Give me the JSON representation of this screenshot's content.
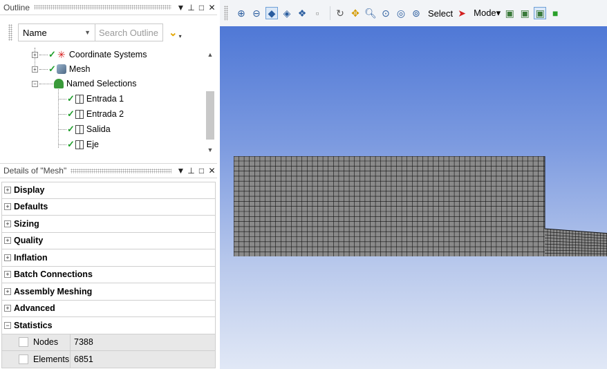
{
  "outline": {
    "title": "Outline",
    "pin": "⊥",
    "restore": "□",
    "close": "✕",
    "dropdown": "▼",
    "filter_select": "Name",
    "search_placeholder": "Search Outline",
    "tree": [
      {
        "label": "Coordinate Systems",
        "icon": "coordinate-systems-icon",
        "expander": "+"
      },
      {
        "label": "Mesh",
        "icon": "mesh-icon",
        "expander": "+"
      },
      {
        "label": "Named Selections",
        "icon": "named-selections-icon",
        "expander": "−"
      },
      {
        "label": "Entrada 1",
        "icon": "face-selection-icon"
      },
      {
        "label": "Entrada 2",
        "icon": "face-selection-icon"
      },
      {
        "label": "Salida",
        "icon": "face-selection-icon"
      },
      {
        "label": "Eje",
        "icon": "face-selection-icon"
      }
    ]
  },
  "details": {
    "title": "Details of \"Mesh\"",
    "sections": [
      {
        "label": "Display",
        "state": "+"
      },
      {
        "label": "Defaults",
        "state": "+"
      },
      {
        "label": "Sizing",
        "state": "+"
      },
      {
        "label": "Quality",
        "state": "+"
      },
      {
        "label": "Inflation",
        "state": "+"
      },
      {
        "label": "Batch Connections",
        "state": "+"
      },
      {
        "label": "Assembly Meshing",
        "state": "+"
      },
      {
        "label": "Advanced",
        "state": "+"
      },
      {
        "label": "Statistics",
        "state": "−"
      }
    ],
    "statistics": [
      {
        "label": "Nodes",
        "value": "7388"
      },
      {
        "label": "Elements",
        "value": "6851"
      }
    ]
  },
  "toolbar": {
    "select_label": "Select",
    "mode_label": "Mode▾"
  },
  "colors": {
    "viewport_top": "#4f78d6",
    "viewport_bottom": "#e1e8f6",
    "mesh_fill": "#8a8a8a",
    "mesh_lines": "#111111",
    "check_green": "#1e9e2a"
  }
}
